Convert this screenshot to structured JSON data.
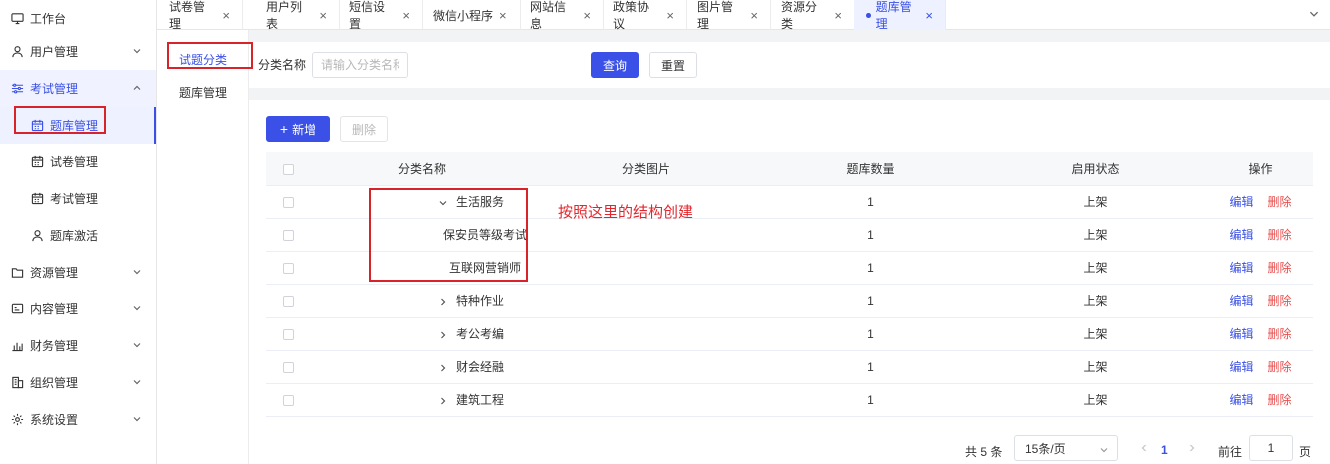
{
  "sidebar": {
    "items": [
      {
        "label": "工作台",
        "icon": "monitor-icon"
      },
      {
        "label": "用户管理",
        "icon": "user-icon"
      },
      {
        "label": "考试管理",
        "icon": "sliders-icon"
      },
      {
        "label": "题库管理",
        "icon": "calendar-icon"
      },
      {
        "label": "试卷管理",
        "icon": "calendar-icon"
      },
      {
        "label": "考试管理",
        "icon": "calendar-icon"
      },
      {
        "label": "题库激活",
        "icon": "user-icon"
      },
      {
        "label": "资源管理",
        "icon": "folder-icon"
      },
      {
        "label": "内容管理",
        "icon": "id-card-icon"
      },
      {
        "label": "财务管理",
        "icon": "bar-chart-icon"
      },
      {
        "label": "组织管理",
        "icon": "building-icon"
      },
      {
        "label": "系统设置",
        "icon": "gear-icon"
      }
    ]
  },
  "tabs": [
    {
      "label": "试卷管理"
    },
    {
      "label": "用户列表"
    },
    {
      "label": "短信设置"
    },
    {
      "label": "微信小程序"
    },
    {
      "label": "网站信息"
    },
    {
      "label": "政策协议"
    },
    {
      "label": "图片管理"
    },
    {
      "label": "资源分类"
    },
    {
      "label": "题库管理"
    }
  ],
  "subnav": {
    "items": [
      {
        "label": "试题分类"
      },
      {
        "label": "题库管理"
      }
    ]
  },
  "search": {
    "label": "分类名称",
    "placeholder": "请输入分类名称",
    "value": "",
    "query_label": "查询",
    "reset_label": "重置"
  },
  "toolbar": {
    "add_label": "新增",
    "delete_label": "删除"
  },
  "table": {
    "headers": [
      "分类名称",
      "分类图片",
      "题库数量",
      "启用状态",
      "操作"
    ],
    "edit_label": "编辑",
    "delete_label": "删除",
    "rows": [
      {
        "name": "生活服务",
        "count": "1",
        "status": "上架"
      },
      {
        "name": "保安员等级考试",
        "count": "1",
        "status": "上架"
      },
      {
        "name": "互联网营销师",
        "count": "1",
        "status": "上架"
      },
      {
        "name": "特种作业",
        "count": "1",
        "status": "上架"
      },
      {
        "name": "考公考编",
        "count": "1",
        "status": "上架"
      },
      {
        "name": "财会经融",
        "count": "1",
        "status": "上架"
      },
      {
        "name": "建筑工程",
        "count": "1",
        "status": "上架"
      }
    ]
  },
  "pager": {
    "total": "共 5 条",
    "size": "15条/页",
    "current": "1",
    "goto": "前往",
    "goto_value": "1",
    "page": "页"
  },
  "annotation": {
    "text": "按照这里的结构创建",
    "color": "#e0272d"
  },
  "colors": {
    "accent": "#3a50e6",
    "danger": "#e84e4e"
  }
}
